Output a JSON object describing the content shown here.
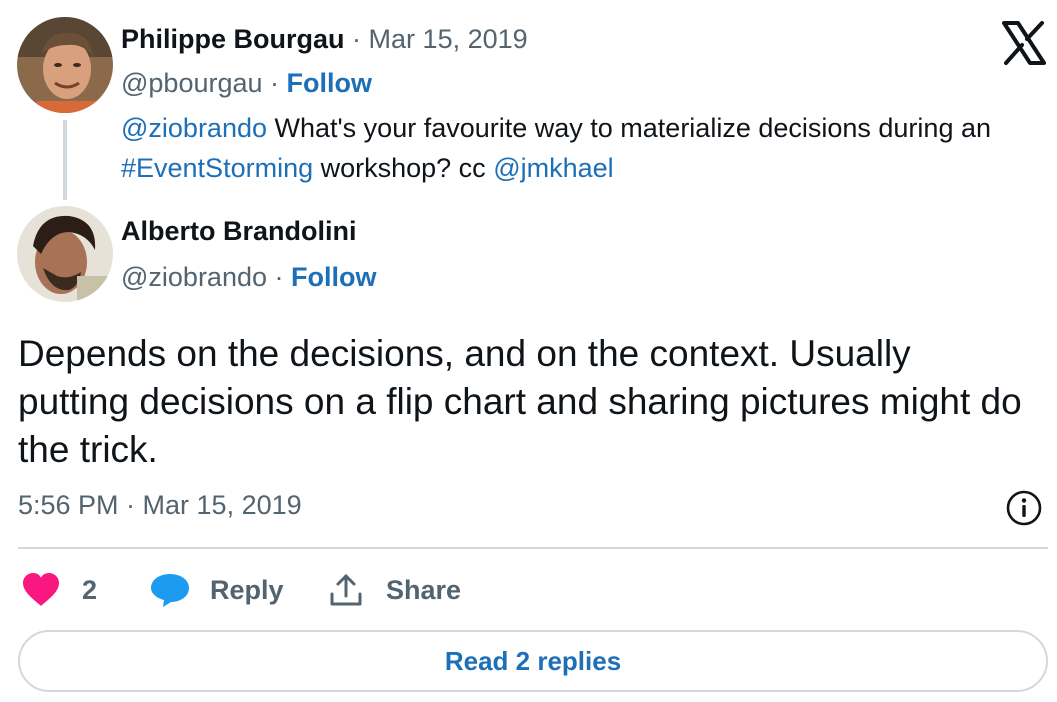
{
  "parent_tweet": {
    "author_name": "Philippe Bourgau",
    "separator": "·",
    "date": "Mar 15, 2019",
    "handle": "@pbourgau",
    "follow_label": "Follow",
    "text_mention": "@ziobrando",
    "text_part1": " What's your favourite way to materialize decisions during an ",
    "text_hashtag": "#EventStorming",
    "text_part2": " workshop? cc ",
    "text_mention2": "@jmkhael"
  },
  "main_tweet": {
    "author_name": "Alberto Brandolini",
    "handle": "@ziobrando",
    "separator": "·",
    "follow_label": "Follow",
    "text": "Depends on the decisions, and on the context. Usually putting decisions on a flip chart and sharing pictures might do the trick.",
    "timestamp": "5:56 PM · Mar 15, 2019"
  },
  "actions": {
    "like_count": "2",
    "reply_label": "Reply",
    "share_label": "Share"
  },
  "read_replies_label": "Read 2 replies",
  "icons": {
    "brand": "x-logo-icon",
    "info": "info-icon",
    "like": "heart-icon",
    "reply": "reply-bubble-icon",
    "share": "share-icon"
  },
  "colors": {
    "link": "#1d6fb8",
    "heart": "#f91880",
    "reply_bubble": "#1d9bf0",
    "muted": "#536471"
  }
}
